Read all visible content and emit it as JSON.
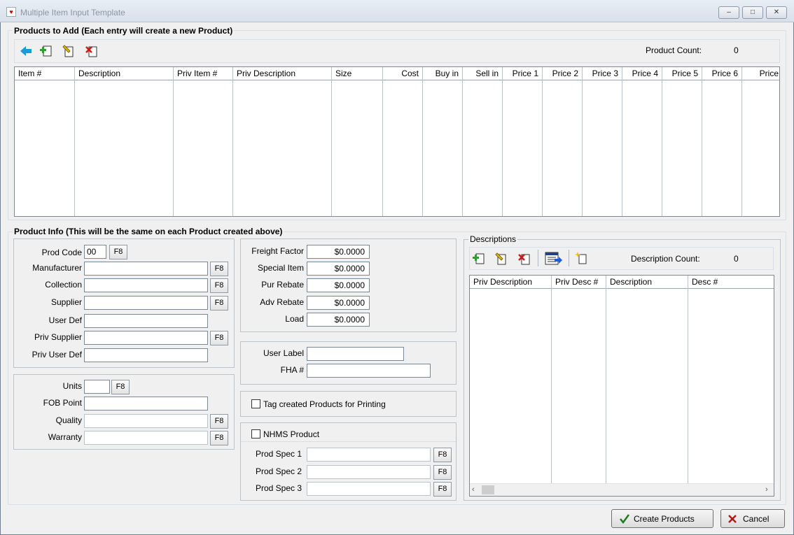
{
  "window": {
    "title": "Multiple Item Input Template",
    "buttons": {
      "minimize": "–",
      "restore": "□",
      "close": "✕"
    }
  },
  "products_to_add": {
    "group_title": "Products to Add  (Each entry will create a new Product)",
    "count_label": "Product Count:",
    "count_value": "0",
    "columns": [
      "Item #",
      "Description",
      "Priv Item #",
      "Priv Description",
      "Size",
      "Cost",
      "Buy in",
      "Sell in",
      "Price 1",
      "Price 2",
      "Price 3",
      "Price 4",
      "Price 5",
      "Price 6",
      "Price"
    ]
  },
  "product_info": {
    "group_title": "Product Info  (This will be the same on each Product created above)",
    "prod_code": {
      "label": "Prod Code",
      "value": "00"
    },
    "manufacturer": {
      "label": "Manufacturer",
      "value": ""
    },
    "collection": {
      "label": "Collection",
      "value": ""
    },
    "supplier": {
      "label": "Supplier",
      "value": ""
    },
    "user_def": {
      "label": "User Def",
      "value": ""
    },
    "priv_supplier": {
      "label": "Priv Supplier",
      "value": ""
    },
    "priv_user_def": {
      "label": "Priv User Def",
      "value": ""
    },
    "units": {
      "label": "Units",
      "value": ""
    },
    "fob_point": {
      "label": "FOB Point",
      "value": ""
    },
    "quality": {
      "label": "Quality",
      "value": ""
    },
    "warranty": {
      "label": "Warranty",
      "value": ""
    },
    "f8_label": "F8",
    "freight_factor": {
      "label": "Freight Factor",
      "value": "$0.0000"
    },
    "special_item": {
      "label": "Special Item",
      "value": "$0.0000"
    },
    "pur_rebate": {
      "label": "Pur Rebate",
      "value": "$0.0000"
    },
    "adv_rebate": {
      "label": "Adv Rebate",
      "value": "$0.0000"
    },
    "load": {
      "label": "Load",
      "value": "$0.0000"
    },
    "user_label": {
      "label": "User Label",
      "value": ""
    },
    "fha": {
      "label": "FHA #",
      "value": ""
    },
    "tag_printing": {
      "label": "Tag created Products for Printing",
      "checked": false
    },
    "nhms_product": {
      "label": "NHMS Product",
      "checked": false
    },
    "prod_spec_1": {
      "label": "Prod Spec 1",
      "value": ""
    },
    "prod_spec_2": {
      "label": "Prod Spec 2",
      "value": ""
    },
    "prod_spec_3": {
      "label": "Prod Spec 3",
      "value": ""
    }
  },
  "descriptions": {
    "group_title": "Descriptions",
    "count_label": "Description Count:",
    "count_value": "0",
    "columns": [
      "Priv Description",
      "Priv Desc #",
      "Description",
      "Desc #"
    ]
  },
  "actions": {
    "create_label": "Create Products",
    "cancel_label": "Cancel"
  },
  "colors": {
    "accent_blue": "#1a9ad6",
    "add_green": "#2ca02c",
    "delete_red": "#d01818"
  }
}
